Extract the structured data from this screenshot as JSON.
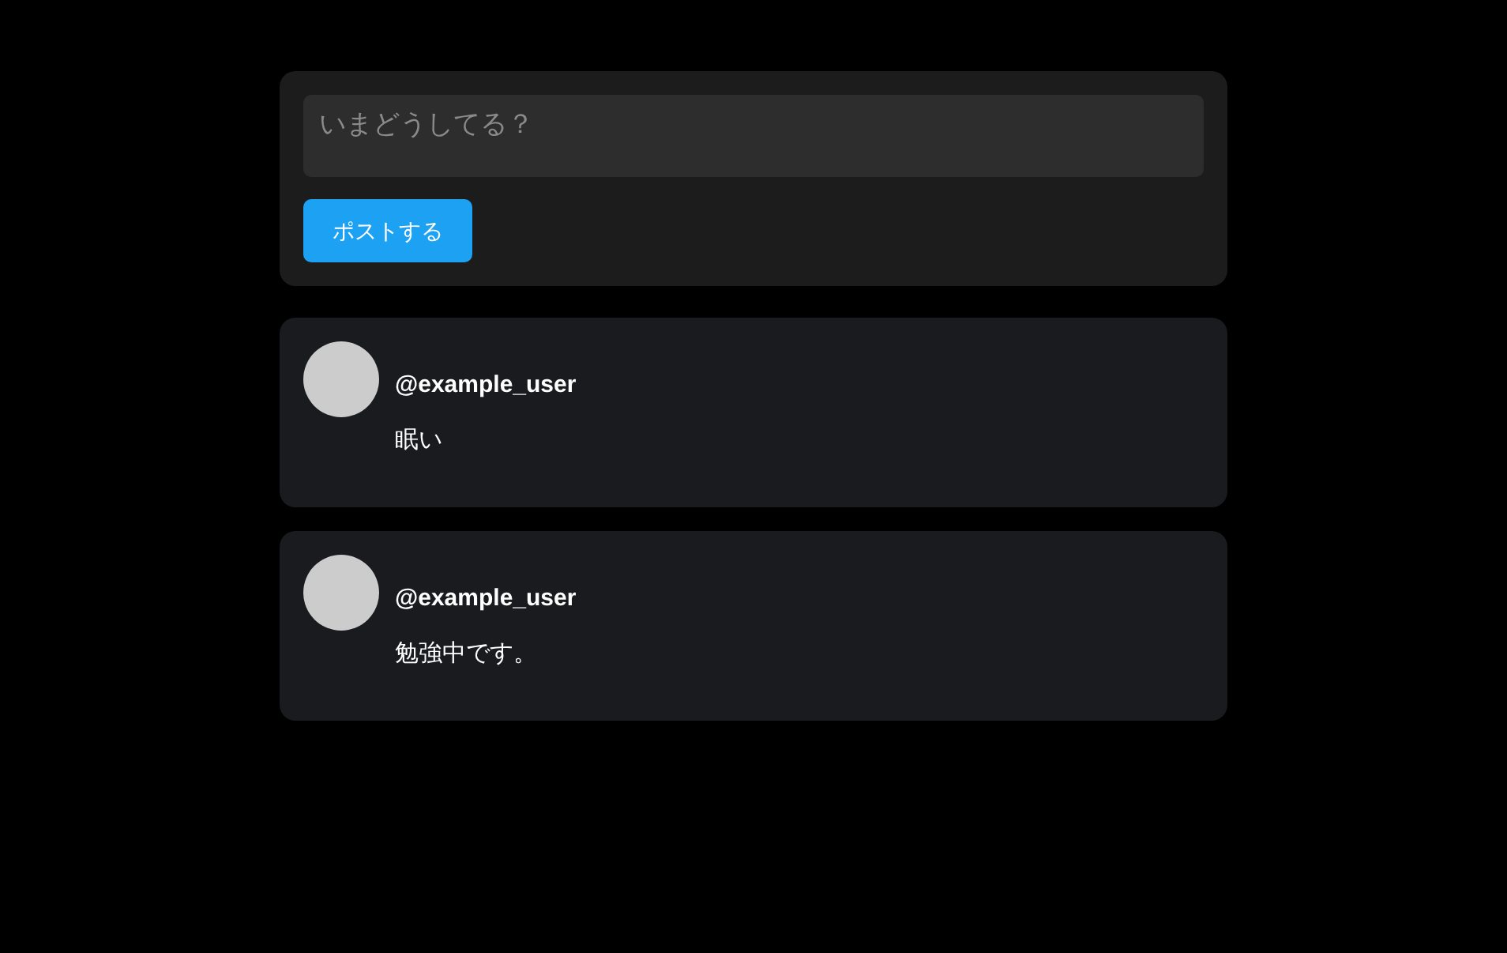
{
  "composer": {
    "placeholder": "いまどうしてる？",
    "button": "ポストする"
  },
  "posts": [
    {
      "username": "@example_user",
      "text": "眠い"
    },
    {
      "username": "@example_user",
      "text": "勉強中です。"
    }
  ]
}
